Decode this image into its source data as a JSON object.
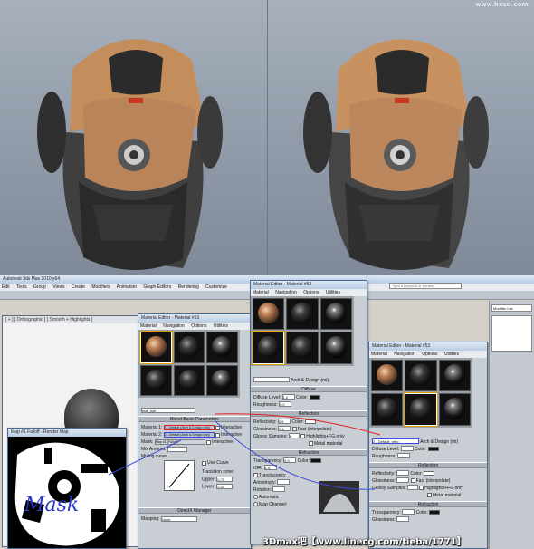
{
  "header": {
    "watermark": "www.hxsd.com"
  },
  "app": {
    "title": "Autodesk 3ds Max 2010 x64",
    "menus": [
      "Edit",
      "Tools",
      "Group",
      "Views",
      "Create",
      "Modifiers",
      "Animation",
      "Graph Editors",
      "Rendering",
      "Customize"
    ],
    "search_placeholder": "Type a keyword or phrase",
    "modifier_list": "Modifier List"
  },
  "viewport": {
    "label": "[ + ] [ Orthographic ] [ Smooth + Highlights ]"
  },
  "mat_editor_back": {
    "title": "Material Editor - Material #53",
    "menus": [
      "Material",
      "Navigation",
      "Options",
      "Utilities"
    ],
    "material_name": "mat_eye",
    "blend_header": "Blend Basic Parameters",
    "material1_label": "Material 1:",
    "material1_value": "1 - Default (Arch & Design (mi))",
    "material2_label": "Material 2:",
    "material2_value": "2 - Default (Arch & Design (mi))",
    "mask_label": "Mask:",
    "mask_value": "Map #1 (Falloff)",
    "interactive": "Interactive",
    "mix_amount": "Mix Amount:",
    "mixing_curve": "Mixing curve",
    "use_curve": "Use Curve",
    "transition_zone": "Transition zone:",
    "upper": "Upper:",
    "upper_value": "0.75",
    "lower": "Lower:",
    "lower_value": "0.25",
    "directx": "DirectX Manager",
    "map_header": "Mapping:",
    "none": "None"
  },
  "mat_editor_mid": {
    "title": "Material Editor - Material #53",
    "menus": [
      "Material",
      "Navigation",
      "Options",
      "Utilities"
    ],
    "material_name": "Arch & Design (mi)",
    "diffuse": "Diffuse",
    "diffuse_level": "Diffuse Level:",
    "diffuse_level_value": "1.0",
    "roughness": "Roughness:",
    "roughness_value": "0.0",
    "color": "Color:",
    "reflection": "Reflection",
    "reflectivity": "Reflectivity:",
    "reflectivity_value": "0.6",
    "glossiness": "Glossiness:",
    "glossiness_value": "0.6",
    "gloss_samples": "Glossy Samples:",
    "gloss_samples_value": "8",
    "fast_interp": "Fast (interpolate)",
    "highlights_fg": "Highlights+FG only",
    "metal_material": "Metal material",
    "refraction": "Refraction",
    "transparency": "Transparency:",
    "transparency_value": "0.0",
    "ior": "IOR:",
    "ior_value": "1.4",
    "translucency": "Translucency",
    "anisotropy": "Anisotropy:",
    "rotation": "Rotation:",
    "automatic": "Automatic",
    "map_channel": "Map Channel:"
  },
  "mat_editor_front": {
    "title": "Material Editor - Material #53",
    "menus": [
      "Material",
      "Navigation",
      "Options",
      "Utilities"
    ],
    "material_name": "2 - Default_reflo",
    "type": "Arch & Design (mi)",
    "diffuse_level": "Diffuse Level:",
    "roughness": "Roughness:",
    "reflection": "Reflection",
    "reflectivity": "Reflectivity:",
    "glossiness": "Glossiness:",
    "glossy_samples": "Glossy Samples:",
    "fast_interp": "Fast (interpolate)",
    "highlights_fg": "Highlights+FG only",
    "metal_material": "Metal material",
    "refraction": "Refraction",
    "transparency": "Transparency:",
    "glossiness2": "Glossiness:",
    "color": "Color:"
  },
  "paint_window": {
    "title": "Map #1 Falloff - Render Map",
    "handwriting": "Mask"
  },
  "caption": "3Dmax吧【www.linecg.com/tieba/1771】"
}
